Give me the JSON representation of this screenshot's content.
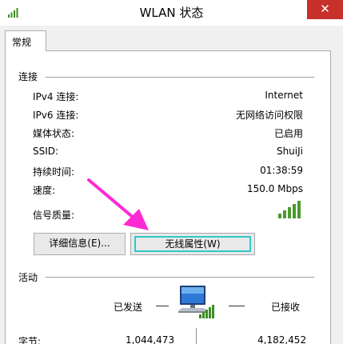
{
  "window": {
    "title": "WLAN 状态",
    "close_glyph": "✕"
  },
  "tabs": [
    {
      "label": "常规"
    }
  ],
  "connection": {
    "heading": "连接",
    "rows": [
      {
        "label": "IPv4 连接:",
        "value": "Internet"
      },
      {
        "label": "IPv6 连接:",
        "value": "无网络访问权限"
      },
      {
        "label": "媒体状态:",
        "value": "已启用"
      },
      {
        "label": "SSID:",
        "value": "ShuiJi"
      },
      {
        "label": "持续时间:",
        "value": "01:38:59"
      },
      {
        "label": "速度:",
        "value": "150.0 Mbps"
      }
    ],
    "signal_label": "信号质量:",
    "signal_bars": 5,
    "signal_bars_active": 5
  },
  "buttons": {
    "details": "详细信息(E)...",
    "wireless_props": "无线属性(W)"
  },
  "activity": {
    "heading": "活动",
    "sent_label": "已发送",
    "received_label": "已接收",
    "bytes_label": "字节:",
    "bytes_sent": "1,044,473",
    "bytes_received": "4,182,452"
  },
  "colors": {
    "signal_green": "#4a9a2e",
    "arrow_magenta": "#ff2ad4",
    "focus_cyan": "#2fc9c8",
    "close_red": "#c7302b"
  }
}
